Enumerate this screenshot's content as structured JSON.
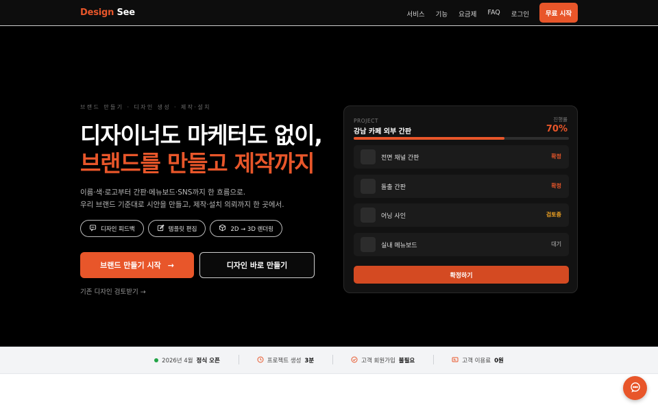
{
  "nav": {
    "logo_part1": "Design",
    "logo_part2": "See",
    "links": [
      "서비스",
      "기능",
      "요금제",
      "FAQ",
      "로그인"
    ],
    "cta": "무료 시작"
  },
  "hero": {
    "eyebrow": "브랜드 만들기 · 디자인 생성 · 제작·설치",
    "title_line1": "디자이너도 마케터도 없이,",
    "title_line2": "브랜드를 만들고 제작까지",
    "subtitle_line1": "이름·색·로고부터 간판·메뉴보드·SNS까지 한 흐름으로.",
    "subtitle_line2": "우리 브랜드 기준대로 시안을 만들고, 제작·설치 의뢰까지 한 곳에서.",
    "chips": [
      {
        "label": "디자인 피드백",
        "icon": "chat-bubble-icon"
      },
      {
        "label": "템플릿 편집",
        "icon": "edit-pencil-icon"
      },
      {
        "label": "2D → 3D 렌더링",
        "icon": "cube-icon"
      }
    ],
    "primary_button": "브랜드 만들기 시작",
    "primary_arrow": "→",
    "secondary_button": "디자인 바로 만들기",
    "review_link": "기존 디자인 검토받기 →"
  },
  "project_card": {
    "label": "PROJECT",
    "title": "강남 카페 외부 간판",
    "progress_label": "진행률",
    "progress_text": "70%",
    "progress": 0.7,
    "items": [
      {
        "name": "전면 채널 간판",
        "status": "확정",
        "status_color": "#e8562a"
      },
      {
        "name": "돌출 간판",
        "status": "확정",
        "status_color": "#e8562a"
      },
      {
        "name": "어닝 사인",
        "status": "검토중",
        "status_color": "#f5a623"
      },
      {
        "name": "실내 메뉴보드",
        "status": "대기",
        "status_color": "#8a8a8a"
      }
    ],
    "confirm_button": "확정하기"
  },
  "stats": [
    {
      "prefix": "2026년 4월",
      "bold": "정식 오픈",
      "icon": "status-dot-icon"
    },
    {
      "prefix": "프로젝트 생성",
      "bold": "3분",
      "icon": "clock-icon"
    },
    {
      "prefix": "고객 회원가입",
      "bold": "불필요",
      "icon": "check-circle-icon"
    },
    {
      "prefix": "고객 이용료",
      "bold": "0원",
      "icon": "wallet-icon"
    }
  ],
  "colors": {
    "accent": "#e8562a",
    "background": "#000000",
    "card": "#121212",
    "online": "#22a447"
  }
}
